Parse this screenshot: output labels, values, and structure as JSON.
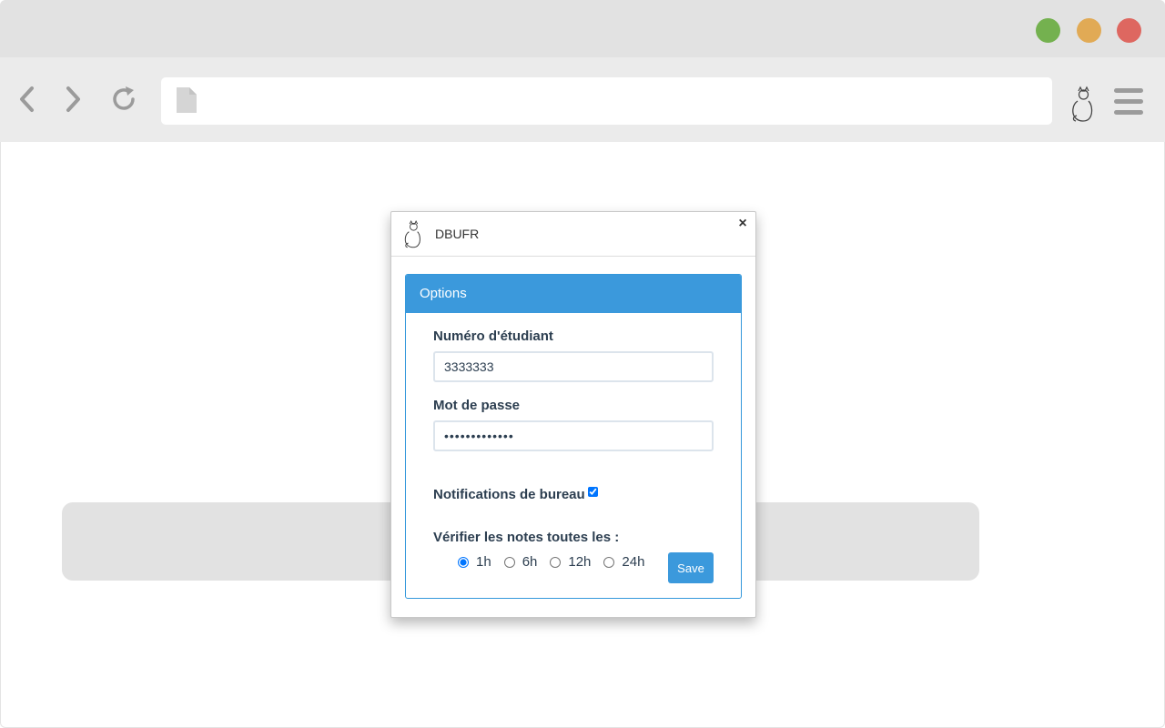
{
  "browser": {
    "traffic_lights": {
      "green": "#74b14f",
      "yellow": "#e1aa55",
      "red": "#de6760"
    },
    "toolbar_icons": [
      "chevron-left-icon",
      "chevron-right-icon",
      "reload-icon",
      "page-icon",
      "extension-cat-icon",
      "hamburger-menu-icon"
    ],
    "url": ""
  },
  "popup": {
    "title": "DBUFR",
    "close_label": "×",
    "panel_heading": "Options",
    "student_number_label": "Numéro d'étudiant",
    "student_number_value": "3333333",
    "password_label": "Mot de passe",
    "password_value": "•••••••••••••",
    "notifications_label": "Notifications de bureau",
    "notifications_checked": true,
    "check_interval_label": "Vérifier les notes toutes les :",
    "intervals": [
      {
        "label": "1h",
        "selected": true
      },
      {
        "label": "6h",
        "selected": false
      },
      {
        "label": "12h",
        "selected": false
      },
      {
        "label": "24h",
        "selected": false
      }
    ],
    "save_label": "Save",
    "accent_color": "#3b99dc"
  }
}
